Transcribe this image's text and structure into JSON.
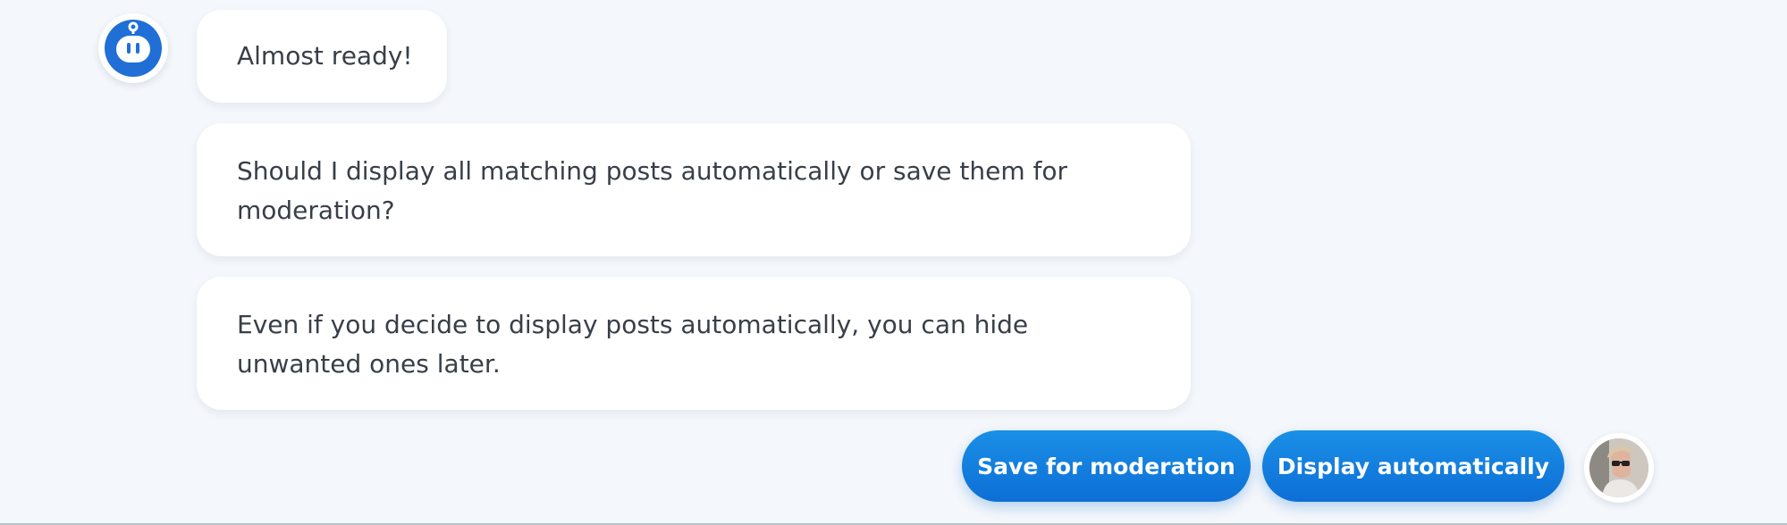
{
  "chat": {
    "bot_avatar_icon": "robot-face-icon",
    "messages": [
      {
        "text": "Almost ready!"
      },
      {
        "text": "Should I display all matching posts automatically or save them for moderation?"
      },
      {
        "text": "Even if you decide to display posts automatically, you can hide unwanted ones later."
      }
    ],
    "replies": [
      {
        "label": "Save for moderation"
      },
      {
        "label": "Display automatically"
      }
    ],
    "user_avatar_icon": "user-photo-avatar"
  },
  "colors": {
    "background": "#f4f7fb",
    "bubble": "#ffffff",
    "accent": "#1a8fe6",
    "text": "#383f49"
  }
}
